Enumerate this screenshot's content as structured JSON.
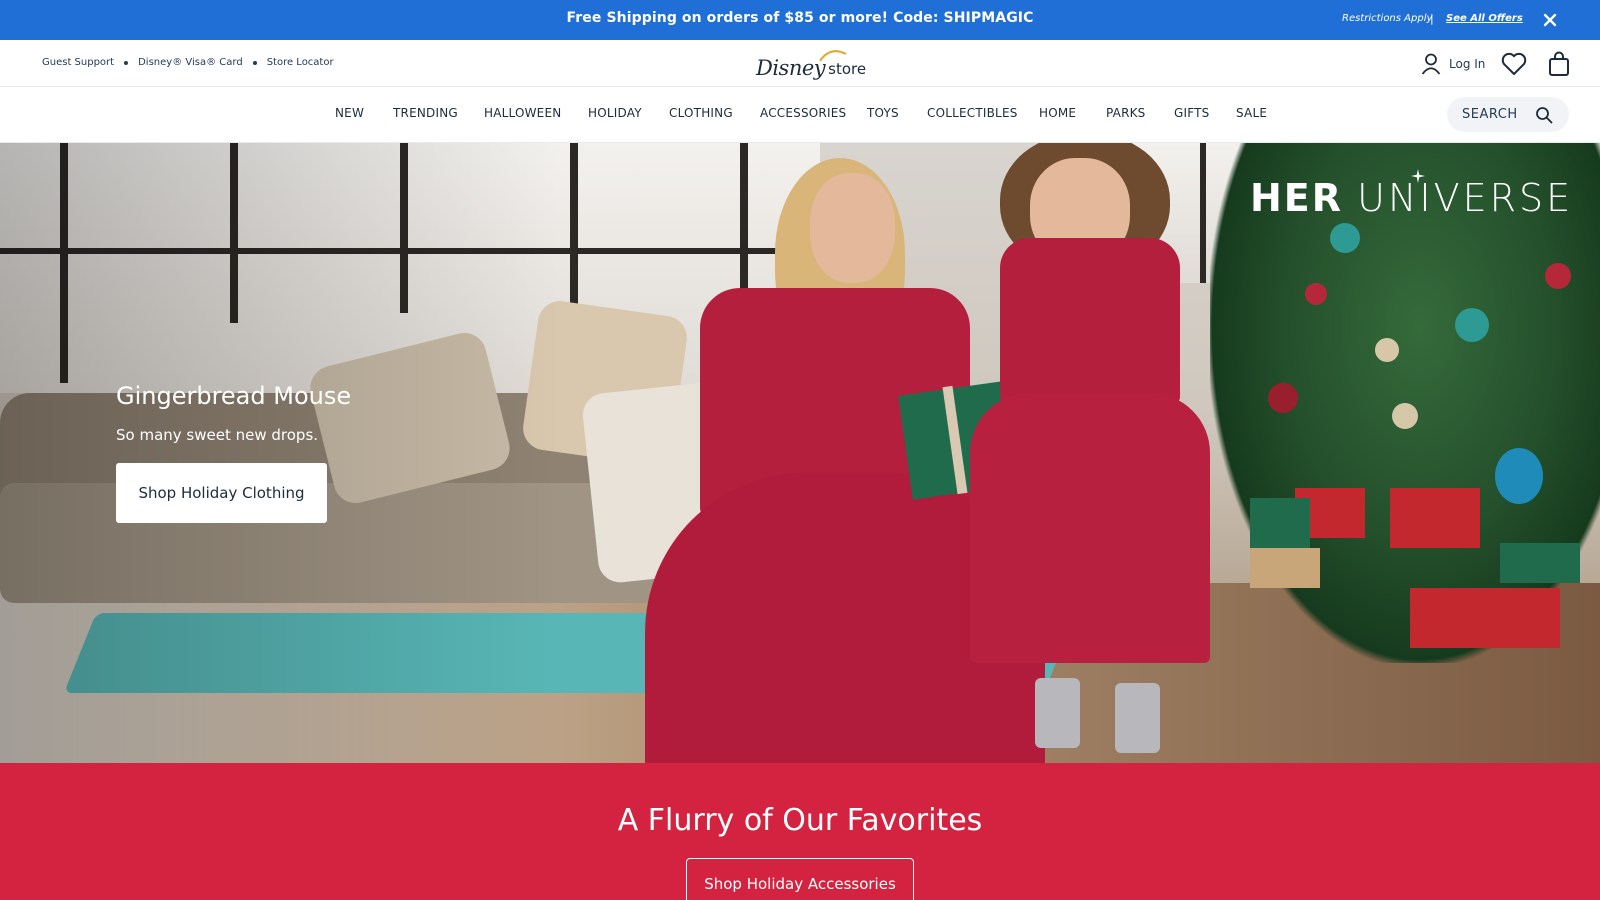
{
  "promo": {
    "message": "Free Shipping on orders of $85 or more! Code: SHIPMAGIC",
    "restrictions": "Restrictions Apply",
    "separator": "|",
    "see_all_offers": "See All Offers",
    "close_icon": "close-icon"
  },
  "utility": {
    "links": [
      "Guest Support",
      "Disney® Visa® Card",
      "Store Locator"
    ],
    "logo_disney": "Disney",
    "logo_store": "store",
    "login_label": "Log In",
    "icons": [
      "user-icon",
      "heart-icon",
      "bag-icon"
    ]
  },
  "nav": {
    "items": [
      "NEW",
      "TRENDING",
      "HALLOWEEN",
      "HOLIDAY",
      "CLOTHING",
      "ACCESSORIES",
      "TOYS",
      "COLLECTIBLES",
      "HOME",
      "PARKS",
      "GIFTS",
      "SALE"
    ],
    "search_label": "SEARCH",
    "search_icon": "search-icon"
  },
  "hero": {
    "brand_bold": "HER",
    "brand_light": "UNIVERSE",
    "title": "Gingerbread Mouse",
    "subtitle": "So many sweet new drops.",
    "cta": "Shop Holiday Clothing"
  },
  "favorites": {
    "title": "A Flurry of Our Favorites",
    "cta": "Shop Holiday Accessories"
  },
  "colors": {
    "promo_blue": "#1f6fd6",
    "section_red": "#d42340",
    "text_navy": "#253b56"
  }
}
